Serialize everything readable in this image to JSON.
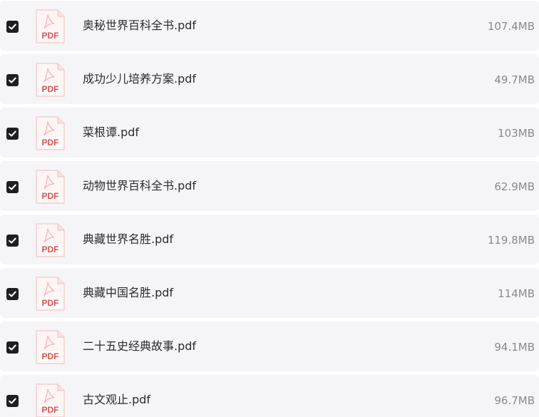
{
  "colors": {
    "row_background": "#f5f5f7",
    "checkbox_fill": "#1f1f1f",
    "pdf_red": "#d9534f",
    "size_text": "#8a8a8f"
  },
  "icons": {
    "checkbox": "checkmark-icon",
    "file": "pdf-file-icon"
  },
  "file_list": {
    "items": [
      {
        "name": "奥秘世界百科全书.pdf",
        "size": "107.4MB",
        "checked": true,
        "icon_label": "PDF"
      },
      {
        "name": "成功少儿培养方案.pdf",
        "size": "49.7MB",
        "checked": true,
        "icon_label": "PDF"
      },
      {
        "name": "菜根谭.pdf",
        "size": "103MB",
        "checked": true,
        "icon_label": "PDF"
      },
      {
        "name": "动物世界百科全书.pdf",
        "size": "62.9MB",
        "checked": true,
        "icon_label": "PDF"
      },
      {
        "name": "典藏世界名胜.pdf",
        "size": "119.8MB",
        "checked": true,
        "icon_label": "PDF"
      },
      {
        "name": "典藏中国名胜.pdf",
        "size": "114MB",
        "checked": true,
        "icon_label": "PDF"
      },
      {
        "name": "二十五史经典故事.pdf",
        "size": "94.1MB",
        "checked": true,
        "icon_label": "PDF"
      },
      {
        "name": "古文观止.pdf",
        "size": "96.7MB",
        "checked": true,
        "icon_label": "PDF"
      }
    ]
  }
}
